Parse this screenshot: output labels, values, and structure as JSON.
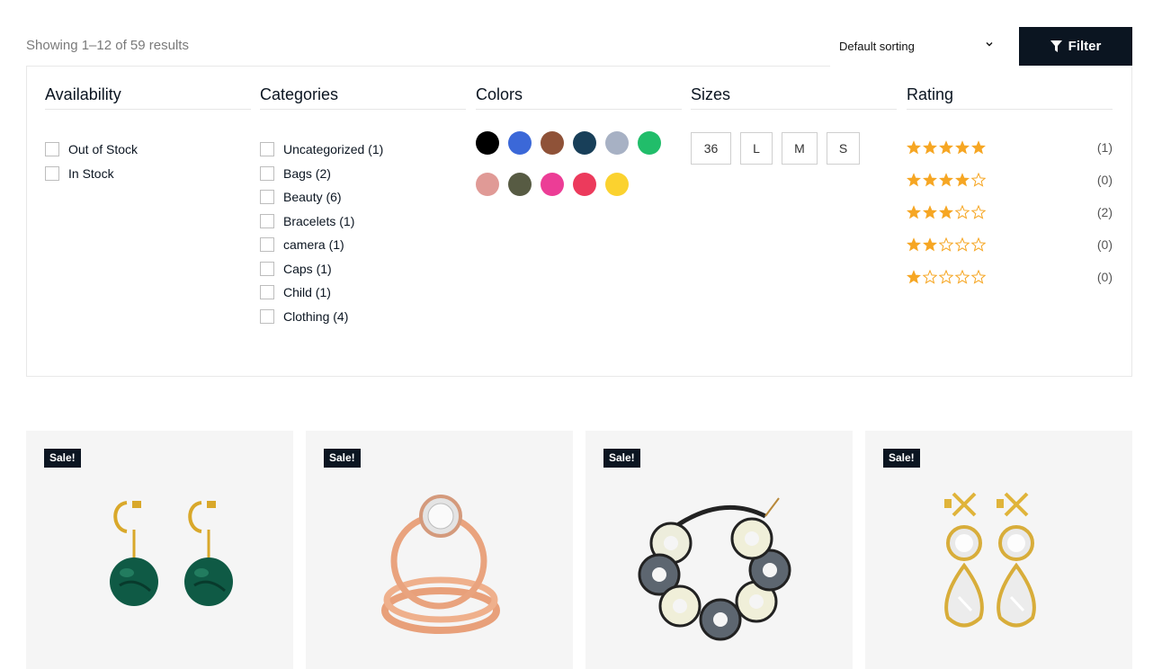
{
  "toolbar": {
    "result_count": "Showing 1–12 of 59 results",
    "sorting_value": "Default sorting",
    "filter_label": "Filter"
  },
  "availability": {
    "title": "Availability",
    "items": [
      "Out of Stock",
      "In Stock"
    ]
  },
  "categories": {
    "title": "Categories",
    "items": [
      "Uncategorized (1)",
      "Bags (2)",
      "Beauty (6)",
      "Bracelets (1)",
      "camera (1)",
      "Caps (1)",
      "Child (1)",
      "Clothing (4)"
    ]
  },
  "colors": {
    "title": "Colors",
    "swatches": [
      "#000000",
      "#3b68d8",
      "#8f5238",
      "#183f59",
      "#a7b1c4",
      "#21bd6a",
      "#e09a96",
      "#575b43",
      "#ec3d96",
      "#ec3a5c",
      "#fbd22f"
    ]
  },
  "sizes": {
    "title": "Sizes",
    "items": [
      "36",
      "L",
      "M",
      "S"
    ]
  },
  "rating": {
    "title": "Rating",
    "rows": [
      {
        "stars": 5,
        "count": "(1)"
      },
      {
        "stars": 4,
        "count": "(0)"
      },
      {
        "stars": 3,
        "count": "(2)"
      },
      {
        "stars": 2,
        "count": "(0)"
      },
      {
        "stars": 1,
        "count": "(0)"
      }
    ],
    "star_color": "#f6a623"
  },
  "products": [
    {
      "badge": "Sale!",
      "image_icon": "malachite-hoop-earrings-image"
    },
    {
      "badge": "Sale!",
      "image_icon": "rose-gold-diamond-rings-image"
    },
    {
      "badge": "Sale!",
      "image_icon": "black-ivory-link-bracelet-image"
    },
    {
      "badge": "Sale!",
      "image_icon": "gold-crystal-drop-earrings-image"
    }
  ],
  "accent_color": "#0b1521"
}
